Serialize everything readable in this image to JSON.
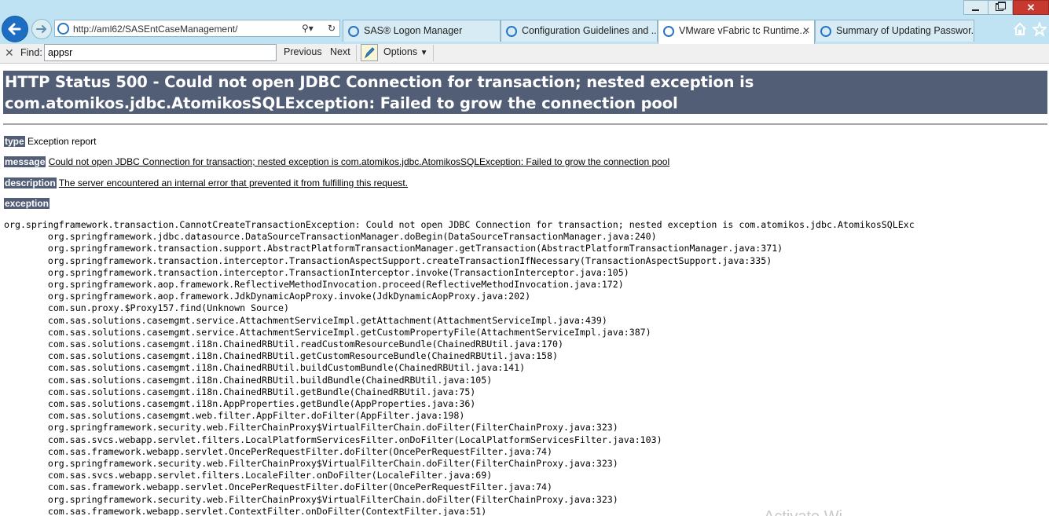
{
  "browser": {
    "address": "http://aml62/SASEntCaseManagement/",
    "tabs": [
      {
        "title": "SAS® Logon Manager",
        "active": false
      },
      {
        "title": "Configuration Guidelines and ...",
        "active": false
      },
      {
        "title": "VMware vFabric tc Runtime...",
        "active": true
      },
      {
        "title": "Summary of Updating Passwor...",
        "active": false
      }
    ]
  },
  "findbar": {
    "label": "Find:",
    "query": "appsr",
    "previous": "Previous",
    "next": "Next",
    "options": "Options"
  },
  "page": {
    "title_line1": "HTTP Status 500 - Could not open JDBC Connection for transaction; nested exception is",
    "title_line2": "com.atomikos.jdbc.AtomikosSQLException: Failed to grow the connection pool",
    "type_label": "type",
    "type_value": "Exception report",
    "message_label": "message",
    "message_value": "Could not open JDBC Connection for transaction; nested exception is com.atomikos.jdbc.AtomikosSQLException: Failed to grow the connection pool",
    "description_label": "description",
    "description_value": "The server encountered an internal error that prevented it from fulfilling this request.",
    "exception_label": "exception",
    "stack_first": "org.springframework.transaction.CannotCreateTransactionException: Could not open JDBC Connection for transaction; nested exception is com.atomikos.jdbc.AtomikosSQLExc",
    "stack_lines": [
      "org.springframework.jdbc.datasource.DataSourceTransactionManager.doBegin(DataSourceTransactionManager.java:240)",
      "org.springframework.transaction.support.AbstractPlatformTransactionManager.getTransaction(AbstractPlatformTransactionManager.java:371)",
      "org.springframework.transaction.interceptor.TransactionAspectSupport.createTransactionIfNecessary(TransactionAspectSupport.java:335)",
      "org.springframework.transaction.interceptor.TransactionInterceptor.invoke(TransactionInterceptor.java:105)",
      "org.springframework.aop.framework.ReflectiveMethodInvocation.proceed(ReflectiveMethodInvocation.java:172)",
      "org.springframework.aop.framework.JdkDynamicAopProxy.invoke(JdkDynamicAopProxy.java:202)",
      "com.sun.proxy.$Proxy157.find(Unknown Source)",
      "com.sas.solutions.casemgmt.service.AttachmentServiceImpl.getAttachment(AttachmentServiceImpl.java:439)",
      "com.sas.solutions.casemgmt.service.AttachmentServiceImpl.getCustomPropertyFile(AttachmentServiceImpl.java:387)",
      "com.sas.solutions.casemgmt.i18n.ChainedRBUtil.readCustomResourceBundle(ChainedRBUtil.java:170)",
      "com.sas.solutions.casemgmt.i18n.ChainedRBUtil.getCustomResourceBundle(ChainedRBUtil.java:158)",
      "com.sas.solutions.casemgmt.i18n.ChainedRBUtil.buildCustomBundle(ChainedRBUtil.java:141)",
      "com.sas.solutions.casemgmt.i18n.ChainedRBUtil.buildBundle(ChainedRBUtil.java:105)",
      "com.sas.solutions.casemgmt.i18n.ChainedRBUtil.getBundle(ChainedRBUtil.java:75)",
      "com.sas.solutions.casemgmt.i18n.AppProperties.getBundle(AppProperties.java:36)",
      "com.sas.solutions.casemgmt.web.filter.AppFilter.doFilter(AppFilter.java:198)",
      "org.springframework.security.web.FilterChainProxy$VirtualFilterChain.doFilter(FilterChainProxy.java:323)",
      "com.sas.svcs.webapp.servlet.filters.LocalPlatformServicesFilter.onDoFilter(LocalPlatformServicesFilter.java:103)",
      "com.sas.framework.webapp.servlet.OncePerRequestFilter.doFilter(OncePerRequestFilter.java:74)",
      "org.springframework.security.web.FilterChainProxy$VirtualFilterChain.doFilter(FilterChainProxy.java:323)",
      "com.sas.svcs.webapp.servlet.filters.LocaleFilter.onDoFilter(LocaleFilter.java:69)",
      "com.sas.framework.webapp.servlet.OncePerRequestFilter.doFilter(OncePerRequestFilter.java:74)",
      "org.springframework.security.web.FilterChainProxy$VirtualFilterChain.doFilter(FilterChainProxy.java:323)",
      "com.sas.framework.webapp.servlet.ContextFilter.onDoFilter(ContextFilter.java:51)"
    ]
  },
  "overlay": {
    "watermark": "Activate Wi..."
  }
}
